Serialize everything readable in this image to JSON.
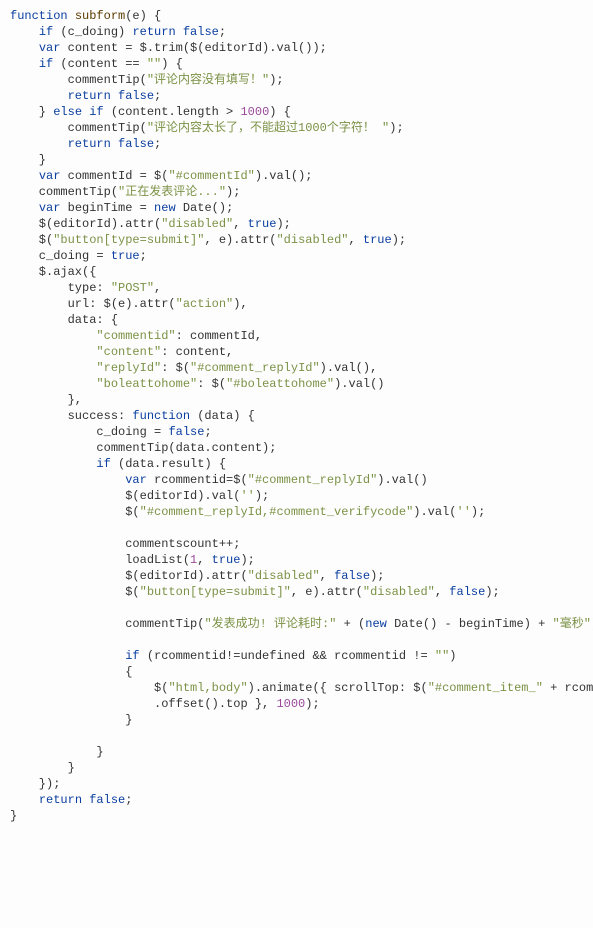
{
  "code_tokens": [
    {
      "t": "k",
      "v": "function"
    },
    {
      "t": "p",
      "v": " "
    },
    {
      "t": "fn",
      "v": "subform"
    },
    {
      "t": "p",
      "v": "(e) {\n"
    },
    {
      "t": "p",
      "v": "    "
    },
    {
      "t": "k",
      "v": "if"
    },
    {
      "t": "p",
      "v": " (c_doing) "
    },
    {
      "t": "k",
      "v": "return"
    },
    {
      "t": "p",
      "v": " "
    },
    {
      "t": "k",
      "v": "false"
    },
    {
      "t": "p",
      "v": ";\n"
    },
    {
      "t": "p",
      "v": "    "
    },
    {
      "t": "k",
      "v": "var"
    },
    {
      "t": "p",
      "v": " content = $.trim($(editorId).val());\n"
    },
    {
      "t": "p",
      "v": "    "
    },
    {
      "t": "k",
      "v": "if"
    },
    {
      "t": "p",
      "v": " (content == "
    },
    {
      "t": "s",
      "v": "\"\""
    },
    {
      "t": "p",
      "v": ") {\n"
    },
    {
      "t": "p",
      "v": "        commentTip("
    },
    {
      "t": "s",
      "v": "\"评论内容没有填写！\""
    },
    {
      "t": "p",
      "v": ");\n"
    },
    {
      "t": "p",
      "v": "        "
    },
    {
      "t": "k",
      "v": "return"
    },
    {
      "t": "p",
      "v": " "
    },
    {
      "t": "k",
      "v": "false"
    },
    {
      "t": "p",
      "v": ";\n"
    },
    {
      "t": "p",
      "v": "    } "
    },
    {
      "t": "k",
      "v": "else"
    },
    {
      "t": "p",
      "v": " "
    },
    {
      "t": "k",
      "v": "if"
    },
    {
      "t": "p",
      "v": " (content.length > "
    },
    {
      "t": "n",
      "v": "1000"
    },
    {
      "t": "p",
      "v": ") {\n"
    },
    {
      "t": "p",
      "v": "        commentTip("
    },
    {
      "t": "s",
      "v": "\"评论内容太长了，不能超过1000个字符！ \""
    },
    {
      "t": "p",
      "v": ");\n"
    },
    {
      "t": "p",
      "v": "        "
    },
    {
      "t": "k",
      "v": "return"
    },
    {
      "t": "p",
      "v": " "
    },
    {
      "t": "k",
      "v": "false"
    },
    {
      "t": "p",
      "v": ";\n"
    },
    {
      "t": "p",
      "v": "    }\n"
    },
    {
      "t": "p",
      "v": "    "
    },
    {
      "t": "k",
      "v": "var"
    },
    {
      "t": "p",
      "v": " commentId = $("
    },
    {
      "t": "s",
      "v": "\"#commentId\""
    },
    {
      "t": "p",
      "v": ").val();\n"
    },
    {
      "t": "p",
      "v": "    commentTip("
    },
    {
      "t": "s",
      "v": "\"正在发表评论...\""
    },
    {
      "t": "p",
      "v": ");\n"
    },
    {
      "t": "p",
      "v": "    "
    },
    {
      "t": "k",
      "v": "var"
    },
    {
      "t": "p",
      "v": " beginTime = "
    },
    {
      "t": "k",
      "v": "new"
    },
    {
      "t": "p",
      "v": " Date();\n"
    },
    {
      "t": "p",
      "v": "    $(editorId).attr("
    },
    {
      "t": "s",
      "v": "\"disabled\""
    },
    {
      "t": "p",
      "v": ", "
    },
    {
      "t": "k",
      "v": "true"
    },
    {
      "t": "p",
      "v": ");\n"
    },
    {
      "t": "p",
      "v": "    $("
    },
    {
      "t": "s",
      "v": "\"button[type=submit]\""
    },
    {
      "t": "p",
      "v": ", e).attr("
    },
    {
      "t": "s",
      "v": "\"disabled\""
    },
    {
      "t": "p",
      "v": ", "
    },
    {
      "t": "k",
      "v": "true"
    },
    {
      "t": "p",
      "v": ");\n"
    },
    {
      "t": "p",
      "v": "    c_doing = "
    },
    {
      "t": "k",
      "v": "true"
    },
    {
      "t": "p",
      "v": ";\n"
    },
    {
      "t": "p",
      "v": "    $.ajax({\n"
    },
    {
      "t": "p",
      "v": "        type: "
    },
    {
      "t": "s",
      "v": "\"POST\""
    },
    {
      "t": "p",
      "v": ",\n"
    },
    {
      "t": "p",
      "v": "        url: $(e).attr("
    },
    {
      "t": "s",
      "v": "\"action\""
    },
    {
      "t": "p",
      "v": "),\n"
    },
    {
      "t": "p",
      "v": "        data: {\n"
    },
    {
      "t": "p",
      "v": "            "
    },
    {
      "t": "s",
      "v": "\"commentid\""
    },
    {
      "t": "p",
      "v": ": commentId,\n"
    },
    {
      "t": "p",
      "v": "            "
    },
    {
      "t": "s",
      "v": "\"content\""
    },
    {
      "t": "p",
      "v": ": content,\n"
    },
    {
      "t": "p",
      "v": "            "
    },
    {
      "t": "s",
      "v": "\"replyId\""
    },
    {
      "t": "p",
      "v": ": $("
    },
    {
      "t": "s",
      "v": "\"#comment_replyId\""
    },
    {
      "t": "p",
      "v": ").val(),\n"
    },
    {
      "t": "p",
      "v": "            "
    },
    {
      "t": "s",
      "v": "\"boleattohome\""
    },
    {
      "t": "p",
      "v": ": $("
    },
    {
      "t": "s",
      "v": "\"#boleattohome\""
    },
    {
      "t": "p",
      "v": ").val()\n"
    },
    {
      "t": "p",
      "v": "        },\n"
    },
    {
      "t": "p",
      "v": "        success: "
    },
    {
      "t": "k",
      "v": "function"
    },
    {
      "t": "p",
      "v": " (data) {\n"
    },
    {
      "t": "p",
      "v": "            c_doing = "
    },
    {
      "t": "k",
      "v": "false"
    },
    {
      "t": "p",
      "v": ";\n"
    },
    {
      "t": "p",
      "v": "            commentTip(data.content);\n"
    },
    {
      "t": "p",
      "v": "            "
    },
    {
      "t": "k",
      "v": "if"
    },
    {
      "t": "p",
      "v": " (data.result) {\n"
    },
    {
      "t": "p",
      "v": "                "
    },
    {
      "t": "k",
      "v": "var"
    },
    {
      "t": "p",
      "v": " rcommentid=$("
    },
    {
      "t": "s",
      "v": "\"#comment_replyId\""
    },
    {
      "t": "p",
      "v": ").val()\n"
    },
    {
      "t": "p",
      "v": "                $(editorId).val("
    },
    {
      "t": "s",
      "v": "''"
    },
    {
      "t": "p",
      "v": ");\n"
    },
    {
      "t": "p",
      "v": "                $("
    },
    {
      "t": "s",
      "v": "\"#comment_replyId,#comment_verifycode\""
    },
    {
      "t": "p",
      "v": ").val("
    },
    {
      "t": "s",
      "v": "''"
    },
    {
      "t": "p",
      "v": ");\n\n"
    },
    {
      "t": "p",
      "v": "                commentscount++;\n"
    },
    {
      "t": "p",
      "v": "                loadList("
    },
    {
      "t": "n",
      "v": "1"
    },
    {
      "t": "p",
      "v": ", "
    },
    {
      "t": "k",
      "v": "true"
    },
    {
      "t": "p",
      "v": ");\n"
    },
    {
      "t": "p",
      "v": "                $(editorId).attr("
    },
    {
      "t": "s",
      "v": "\"disabled\""
    },
    {
      "t": "p",
      "v": ", "
    },
    {
      "t": "k",
      "v": "false"
    },
    {
      "t": "p",
      "v": ");\n"
    },
    {
      "t": "p",
      "v": "                $("
    },
    {
      "t": "s",
      "v": "\"button[type=submit]\""
    },
    {
      "t": "p",
      "v": ", e).attr("
    },
    {
      "t": "s",
      "v": "\"disabled\""
    },
    {
      "t": "p",
      "v": ", "
    },
    {
      "t": "k",
      "v": "false"
    },
    {
      "t": "p",
      "v": ");\n\n"
    },
    {
      "t": "p",
      "v": "                commentTip("
    },
    {
      "t": "s",
      "v": "\"发表成功! 评论耗时:\""
    },
    {
      "t": "p",
      "v": " + ("
    },
    {
      "t": "k",
      "v": "new"
    },
    {
      "t": "p",
      "v": " Date() - beginTime) + "
    },
    {
      "t": "s",
      "v": "\"毫秒\""
    },
    {
      "t": "p",
      "v": ")\n\n"
    },
    {
      "t": "p",
      "v": "                "
    },
    {
      "t": "k",
      "v": "if"
    },
    {
      "t": "p",
      "v": " (rcommentid!=undefined && rcommentid != "
    },
    {
      "t": "s",
      "v": "\"\""
    },
    {
      "t": "p",
      "v": ")\n"
    },
    {
      "t": "p",
      "v": "                {\n"
    },
    {
      "t": "p",
      "v": "                    $("
    },
    {
      "t": "s",
      "v": "\"html,body\""
    },
    {
      "t": "p",
      "v": ").animate({ scrollTop: $("
    },
    {
      "t": "s",
      "v": "\"#comment_item_\""
    },
    {
      "t": "p",
      "v": " + rcommentid)\n"
    },
    {
      "t": "p",
      "v": "                    .offset().top }, "
    },
    {
      "t": "n",
      "v": "1000"
    },
    {
      "t": "p",
      "v": ");\n"
    },
    {
      "t": "p",
      "v": "                }\n\n"
    },
    {
      "t": "p",
      "v": "            }\n"
    },
    {
      "t": "p",
      "v": "        }\n"
    },
    {
      "t": "p",
      "v": "    });\n"
    },
    {
      "t": "p",
      "v": "    "
    },
    {
      "t": "k",
      "v": "return"
    },
    {
      "t": "p",
      "v": " "
    },
    {
      "t": "k",
      "v": "false"
    },
    {
      "t": "p",
      "v": ";\n"
    },
    {
      "t": "p",
      "v": "}"
    }
  ]
}
